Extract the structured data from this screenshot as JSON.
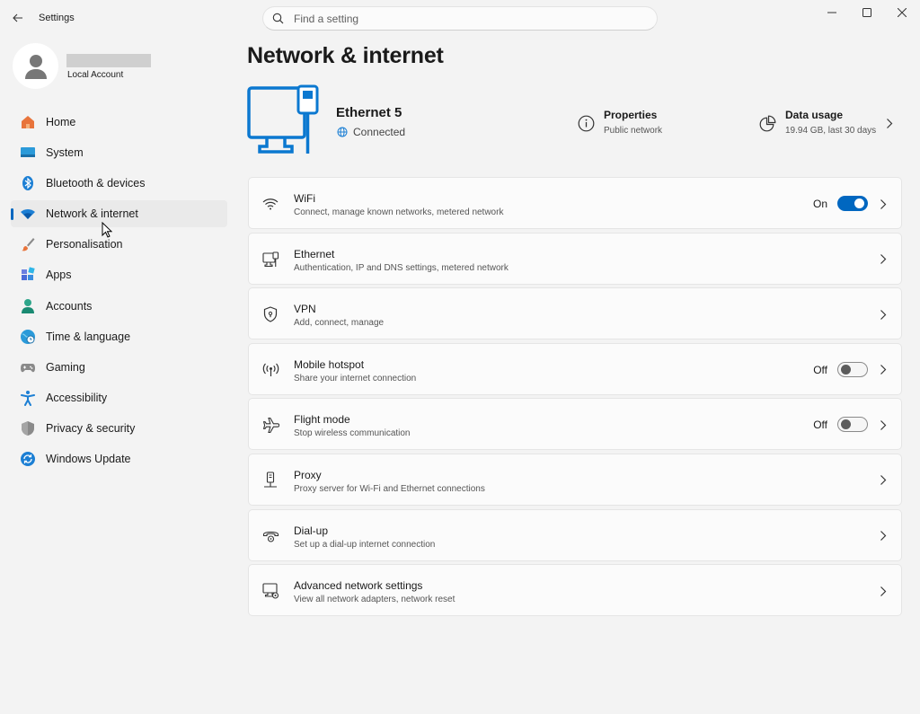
{
  "window": {
    "title": "Settings"
  },
  "search": {
    "placeholder": "Find a setting"
  },
  "profile": {
    "account_type": "Local Account"
  },
  "sidebar": {
    "items": [
      {
        "label": "Home",
        "icon": "home-icon"
      },
      {
        "label": "System",
        "icon": "system-icon"
      },
      {
        "label": "Bluetooth & devices",
        "icon": "bluetooth-icon"
      },
      {
        "label": "Network & internet",
        "icon": "wifi-icon",
        "selected": true
      },
      {
        "label": "Personalisation",
        "icon": "brush-icon"
      },
      {
        "label": "Apps",
        "icon": "apps-icon"
      },
      {
        "label": "Accounts",
        "icon": "accounts-icon"
      },
      {
        "label": "Time & language",
        "icon": "globe-clock-icon"
      },
      {
        "label": "Gaming",
        "icon": "gamepad-icon"
      },
      {
        "label": "Accessibility",
        "icon": "accessibility-icon"
      },
      {
        "label": "Privacy & security",
        "icon": "shield-icon"
      },
      {
        "label": "Windows Update",
        "icon": "update-icon"
      }
    ]
  },
  "main": {
    "title": "Network & internet",
    "adapter": {
      "name": "Ethernet 5",
      "status": "Connected"
    },
    "properties": {
      "title": "Properties",
      "subtitle": "Public network"
    },
    "data_usage": {
      "title": "Data usage",
      "subtitle": "19.94 GB, last 30 days"
    },
    "cards": [
      {
        "title": "WiFi",
        "desc": "Connect, manage known networks, metered network",
        "icon": "wifi-icon",
        "toggle": "On"
      },
      {
        "title": "Ethernet",
        "desc": "Authentication, IP and DNS settings, metered network",
        "icon": "ethernet-icon"
      },
      {
        "title": "VPN",
        "desc": "Add, connect, manage",
        "icon": "vpn-shield-icon"
      },
      {
        "title": "Mobile hotspot",
        "desc": "Share your internet connection",
        "icon": "hotspot-icon",
        "toggle": "Off"
      },
      {
        "title": "Flight mode",
        "desc": "Stop wireless communication",
        "icon": "airplane-icon",
        "toggle": "Off"
      },
      {
        "title": "Proxy",
        "desc": "Proxy server for Wi-Fi and Ethernet connections",
        "icon": "proxy-icon"
      },
      {
        "title": "Dial-up",
        "desc": "Set up a dial-up internet connection",
        "icon": "dialup-icon"
      },
      {
        "title": "Advanced network settings",
        "desc": "View all network adapters, network reset",
        "icon": "advanced-network-icon"
      }
    ]
  },
  "colors": {
    "accent": "#0067c0",
    "background": "#f3f3f3",
    "card": "#fbfbfb"
  }
}
